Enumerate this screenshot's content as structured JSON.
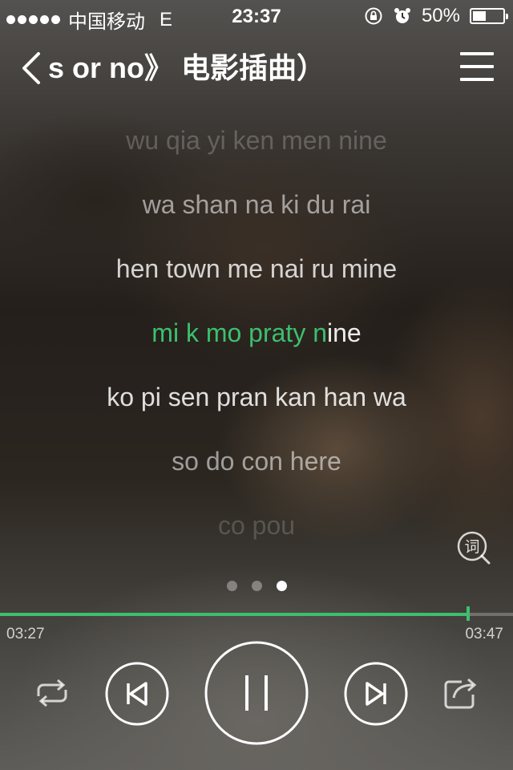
{
  "status_bar": {
    "carrier": "中国移动",
    "network": "E",
    "time": "23:37",
    "battery": "50%",
    "battery_level": 0.5
  },
  "nav": {
    "title": "s or no》 电影插曲）"
  },
  "lyrics": {
    "lines": [
      "wu qia yi ken men nine",
      "wa shan na ki du rai",
      "hen town me nai ru mine",
      "mi k mo praty nine",
      "ko pi sen pran kan han wa",
      "so do con here",
      "co pou"
    ],
    "current_sung": "mi k mo praty n",
    "current_rest": "ine"
  },
  "lyric_button_label": "词",
  "pager": {
    "pages": 3,
    "active": 3
  },
  "player": {
    "current_time": "03:27",
    "total_time": "03:47",
    "progress": 0.913
  },
  "colors": {
    "accent": "#3cc06d"
  }
}
